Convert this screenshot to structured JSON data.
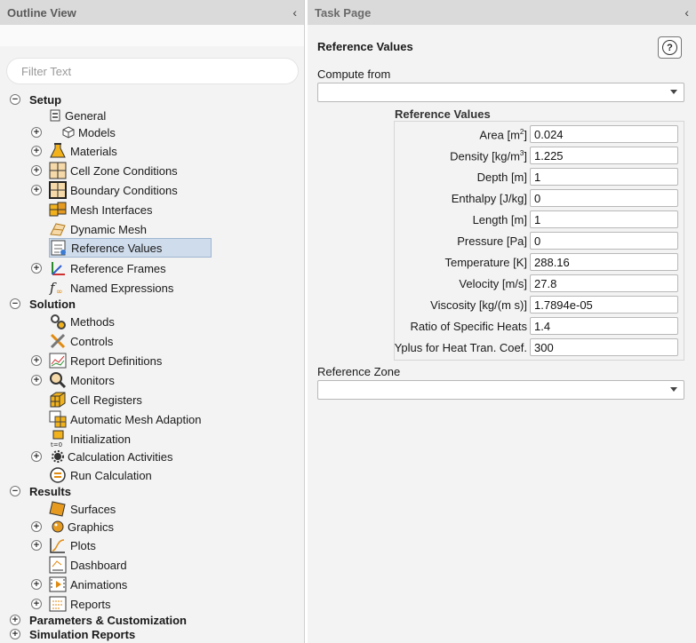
{
  "outline": {
    "title": "Outline View",
    "collapse_glyph": "‹",
    "filter_placeholder": "Filter Text",
    "tree": [
      {
        "label": "Setup",
        "category": true
      },
      {
        "label": "General"
      },
      {
        "label": "Models",
        "expandable": true
      },
      {
        "label": "Materials",
        "expandable": true
      },
      {
        "label": "Cell Zone Conditions",
        "expandable": true
      },
      {
        "label": "Boundary Conditions",
        "expandable": true
      },
      {
        "label": "Mesh Interfaces"
      },
      {
        "label": "Dynamic Mesh"
      },
      {
        "label": "Reference Values",
        "selected": true
      },
      {
        "label": "Reference Frames",
        "expandable": true
      },
      {
        "label": "Named Expressions"
      },
      {
        "label": "Solution",
        "category": true
      },
      {
        "label": "Methods"
      },
      {
        "label": "Controls"
      },
      {
        "label": "Report Definitions",
        "expandable": true
      },
      {
        "label": "Monitors",
        "expandable": true
      },
      {
        "label": "Cell Registers"
      },
      {
        "label": "Automatic Mesh Adaption"
      },
      {
        "label": "Initialization"
      },
      {
        "label": "Calculation Activities",
        "expandable": true
      },
      {
        "label": "Run Calculation"
      },
      {
        "label": "Results",
        "category": true
      },
      {
        "label": "Surfaces"
      },
      {
        "label": "Graphics",
        "expandable": true
      },
      {
        "label": "Plots",
        "expandable": true
      },
      {
        "label": "Dashboard"
      },
      {
        "label": "Animations",
        "expandable": true
      },
      {
        "label": "Reports",
        "expandable": true
      },
      {
        "label": "Parameters & Customization",
        "category": true,
        "collapsed": true
      },
      {
        "label": "Simulation Reports",
        "category": true,
        "collapsed": true
      }
    ]
  },
  "task": {
    "title": "Task Page",
    "collapse_glyph": "‹",
    "page_title": "Reference Values",
    "help_glyph": "?",
    "compute_from_label": "Compute from",
    "compute_from_value": "",
    "group_title": "Reference Values",
    "reference_zone_label": "Reference Zone",
    "reference_zone_value": ""
  },
  "params": {
    "area": {
      "label": "Area [m",
      "sup": "2",
      "label_end": "]",
      "value": "0.024"
    },
    "density": {
      "label": "Density [kg/m",
      "sup": "3",
      "label_end": "]",
      "value": "1.225"
    },
    "depth": {
      "label": "Depth [m]",
      "value": "1"
    },
    "enthalpy": {
      "label": "Enthalpy [J/kg]",
      "value": "0"
    },
    "length": {
      "label": "Length [m]",
      "value": "1"
    },
    "pressure": {
      "label": "Pressure [Pa]",
      "value": "0"
    },
    "temperature": {
      "label": "Temperature [K]",
      "value": "288.16"
    },
    "velocity": {
      "label": "Velocity [m/s]",
      "value": "27.8"
    },
    "viscosity": {
      "label": "Viscosity [kg/(m s)]",
      "value": "1.7894e-05"
    },
    "ratio": {
      "label": "Ratio of Specific Heats",
      "value": "1.4"
    },
    "yplus": {
      "label": "Yplus for Heat Tran. Coef.",
      "value": "300"
    }
  }
}
